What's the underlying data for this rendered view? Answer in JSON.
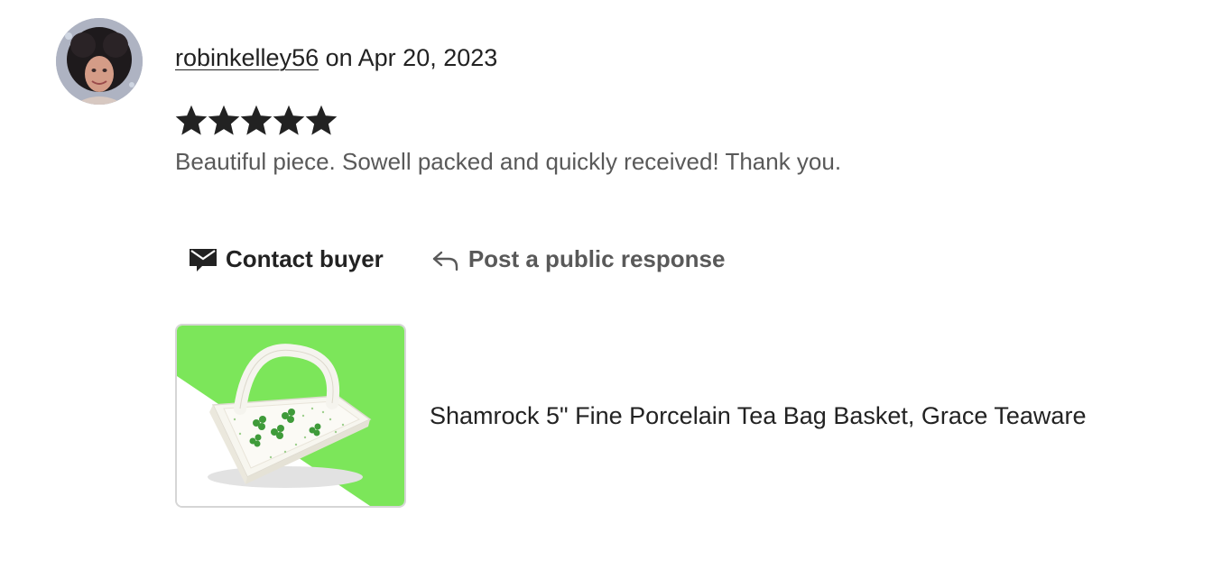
{
  "review": {
    "reviewer": "robinkelley56",
    "date_text": " on Apr 20, 2023",
    "rating": 5,
    "rating_max": 5,
    "text": "Beautiful piece. Sowell packed and quickly received! Thank you."
  },
  "actions": {
    "contact_label": "Contact buyer",
    "contact_icon": "envelope-icon",
    "respond_label": "Post a public response",
    "respond_icon": "reply-arrow-icon"
  },
  "product": {
    "title": "Shamrock 5\" Fine Porcelain Tea Bag Basket, Grace Teaware",
    "thumbnail_bg_color": "#7ce65a"
  },
  "colors": {
    "text_primary": "#222222",
    "text_secondary": "#595959",
    "star": "#222222"
  }
}
